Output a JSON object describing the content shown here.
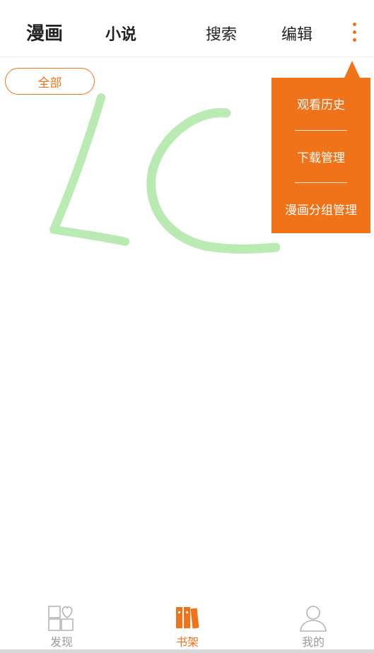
{
  "header": {
    "tabs": [
      {
        "label": "漫画",
        "active": true
      },
      {
        "label": "小说",
        "active": false
      }
    ],
    "actions": {
      "search_label": "搜索",
      "edit_label": "编辑",
      "more_icon": "more-vertical-icon"
    }
  },
  "filter": {
    "chip_label": "全部"
  },
  "popup_menu": {
    "items": [
      {
        "label": "观看历史"
      },
      {
        "label": "下载管理"
      },
      {
        "label": "漫画分组管理"
      }
    ]
  },
  "bottom_nav": {
    "items": [
      {
        "label": "发现",
        "icon": "discover-grid-heart-icon",
        "active": false
      },
      {
        "label": "书架",
        "icon": "bookshelf-icon",
        "active": true
      },
      {
        "label": "我的",
        "icon": "person-icon",
        "active": false
      }
    ]
  },
  "colors": {
    "accent": "#f07219",
    "text_primary": "#222222",
    "text_muted": "#9a9a9a",
    "doodle": "#a8e6a0"
  }
}
